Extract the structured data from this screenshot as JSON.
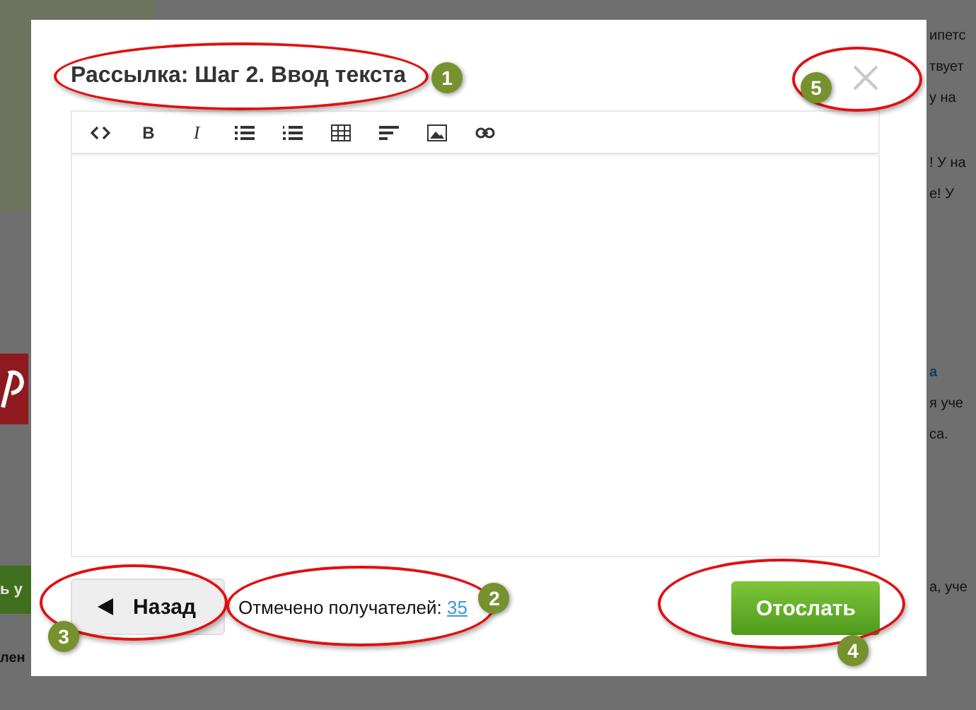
{
  "background_page": {
    "texts": [
      {
        "text": "ипетс",
        "link": false
      },
      {
        "text": "твует",
        "link": false
      },
      {
        "text": "у на",
        "link": false
      },
      {
        "text": "! У на",
        "link": false
      },
      {
        "text": "е! У",
        "link": false
      },
      {
        "text": "а",
        "link": true
      },
      {
        "text": "я уче",
        "link": false
      },
      {
        "text": "са.",
        "link": false
      },
      {
        "text": "а, уче",
        "link": false
      }
    ],
    "green_button": "ь у",
    "left_label": "лен"
  },
  "dialog": {
    "title": "Рассылка: Шаг 2. Ввод текста",
    "title_marker": "1",
    "close_marker": "5",
    "toolbar": [
      {
        "kind": "code"
      },
      {
        "kind": "bold",
        "label": "B"
      },
      {
        "kind": "italic",
        "label": "I"
      },
      {
        "kind": "bullets"
      },
      {
        "kind": "numbers"
      },
      {
        "kind": "table"
      },
      {
        "kind": "align"
      },
      {
        "kind": "image"
      },
      {
        "kind": "link"
      }
    ],
    "back_button": {
      "label": "Назад",
      "marker": "3"
    },
    "recipients": {
      "label": "Отмечено получателей:",
      "count": "35",
      "marker": "2"
    },
    "send_button": {
      "label": "Отослать",
      "marker": "4"
    }
  }
}
